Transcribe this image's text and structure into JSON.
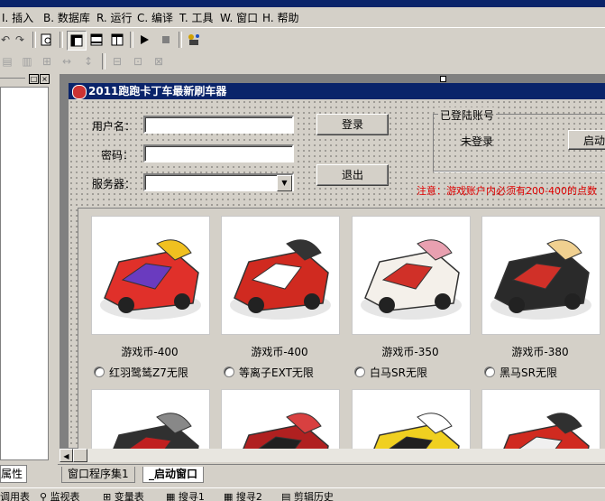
{
  "menu": {
    "items": [
      {
        "key": "I",
        "label": "插入"
      },
      {
        "key": "B",
        "label": "数据库"
      },
      {
        "key": "R",
        "label": "运行"
      },
      {
        "key": "C",
        "label": "编译"
      },
      {
        "key": "T",
        "label": "工具"
      },
      {
        "key": "W",
        "label": "窗口"
      },
      {
        "key": "H",
        "label": "帮助"
      }
    ]
  },
  "left_panel": {
    "tab_label": "属性"
  },
  "window": {
    "title": "2011跑跑卡丁车最新刷车器"
  },
  "login": {
    "username_label": "用户名：",
    "password_label": "密码：",
    "server_label": "服务器：",
    "username_value": "",
    "password_value": "",
    "server_value": "",
    "login_button": "登录",
    "exit_button": "退出"
  },
  "account_group": {
    "title": "已登陆账号",
    "status": "未登录",
    "start_button": "启动"
  },
  "notice": "注意：游戏账户内必须有200-400的点数",
  "cars": [
    {
      "price": "游戏币-400",
      "name": "红羽鹭鸶Z7无限",
      "colors": [
        "#e0302a",
        "#6a3bbf",
        "#f0c020"
      ]
    },
    {
      "price": "游戏币-400",
      "name": "等离子EXT无限",
      "colors": [
        "#d02a20",
        "#ffffff",
        "#333333"
      ]
    },
    {
      "price": "游戏币-350",
      "name": "白马SR无限",
      "colors": [
        "#f4f0ea",
        "#d03028",
        "#e8a0b0"
      ]
    },
    {
      "price": "游戏币-380",
      "name": "黑马SR无限",
      "colors": [
        "#2a2a2a",
        "#d03028",
        "#f0d090"
      ]
    },
    {
      "price": "",
      "name": "",
      "colors": [
        "#303030",
        "#c02020",
        "#888888"
      ]
    },
    {
      "price": "",
      "name": "",
      "colors": [
        "#b02020",
        "#202020",
        "#d84040"
      ]
    },
    {
      "price": "",
      "name": "",
      "colors": [
        "#f0d020",
        "#202020",
        "#ffffff"
      ]
    },
    {
      "price": "",
      "name": "",
      "colors": [
        "#d02a20",
        "#f0f0f0",
        "#303030"
      ]
    }
  ],
  "design_tabs": [
    {
      "label": "窗口程序集1"
    },
    {
      "label": "_启动窗口"
    }
  ],
  "status_bar": {
    "items": [
      "调用表",
      "监视表",
      "变量表",
      "搜寻1",
      "搜寻2",
      "剪辑历史"
    ]
  }
}
